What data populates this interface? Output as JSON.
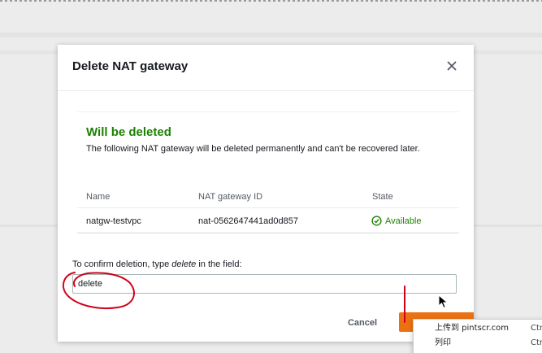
{
  "modal": {
    "title": "Delete NAT gateway",
    "close_icon": "close-icon"
  },
  "warning": {
    "title": "Will be deleted",
    "message": "The following NAT gateway will be deleted permanently and can't be recovered later."
  },
  "table": {
    "columns": [
      "Name",
      "NAT gateway ID",
      "State"
    ],
    "rows": [
      {
        "name": "natgw-testvpc",
        "id": "nat-0562647441ad0d857",
        "state": "Available"
      }
    ]
  },
  "confirm": {
    "label_prefix": "To confirm deletion, type ",
    "label_keyword": "delete",
    "label_suffix": " in the field:",
    "value": "delete"
  },
  "buttons": {
    "cancel": "Cancel",
    "delete": ""
  },
  "context_menu": {
    "items": [
      {
        "label": "上传到 pintscr.com",
        "shortcut": "Ctr"
      },
      {
        "label": "列印",
        "shortcut": "Ctr"
      }
    ]
  },
  "colors": {
    "success": "#1d8102",
    "primary": "#ec7211",
    "annotation": "#d0021b"
  }
}
